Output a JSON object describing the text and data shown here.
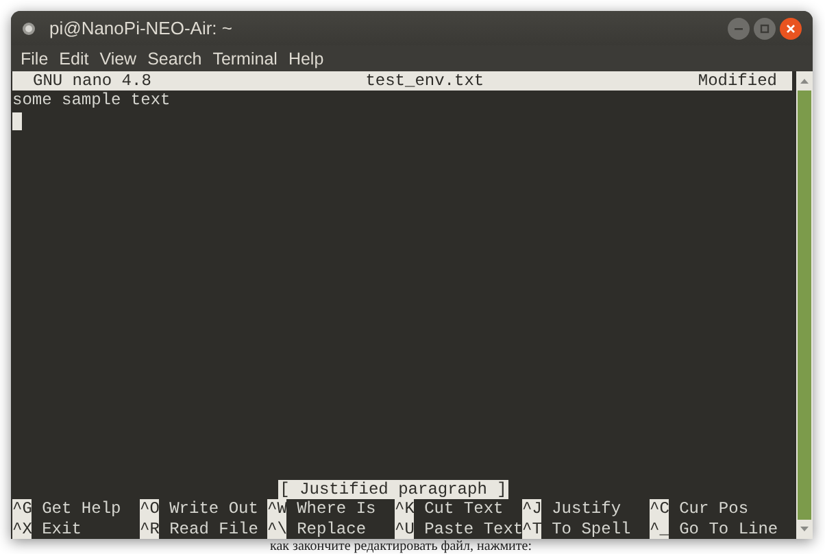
{
  "window": {
    "title": "pi@NanoPi-NEO-Air: ~"
  },
  "menu": [
    "File",
    "Edit",
    "View",
    "Search",
    "Terminal",
    "Help"
  ],
  "nano": {
    "version": "GNU nano 4.8",
    "filename": "test_env.txt",
    "state": "Modified"
  },
  "lines": [
    {
      "kind": "text",
      "text": "some sample text"
    },
    {
      "kind": "cursor"
    }
  ],
  "status": "[ Justified paragraph ]",
  "shortcuts": [
    [
      {
        "key": "^G",
        "label": "Get Help"
      },
      {
        "key": "^O",
        "label": "Write Out"
      },
      {
        "key": "^W",
        "label": "Where Is"
      },
      {
        "key": "^K",
        "label": "Cut Text"
      },
      {
        "key": "^J",
        "label": "Justify"
      },
      {
        "key": "^C",
        "label": "Cur Pos"
      }
    ],
    [
      {
        "key": "^X",
        "label": "Exit"
      },
      {
        "key": "^R",
        "label": "Read File"
      },
      {
        "key": "^\\",
        "label": "Replace"
      },
      {
        "key": "^U",
        "label": "Paste Text"
      },
      {
        "key": "^T",
        "label": "To Spell"
      },
      {
        "key": "^_",
        "label": "Go To Line"
      }
    ]
  ],
  "background_text": "как закончите редактировать файл, нажмите:"
}
